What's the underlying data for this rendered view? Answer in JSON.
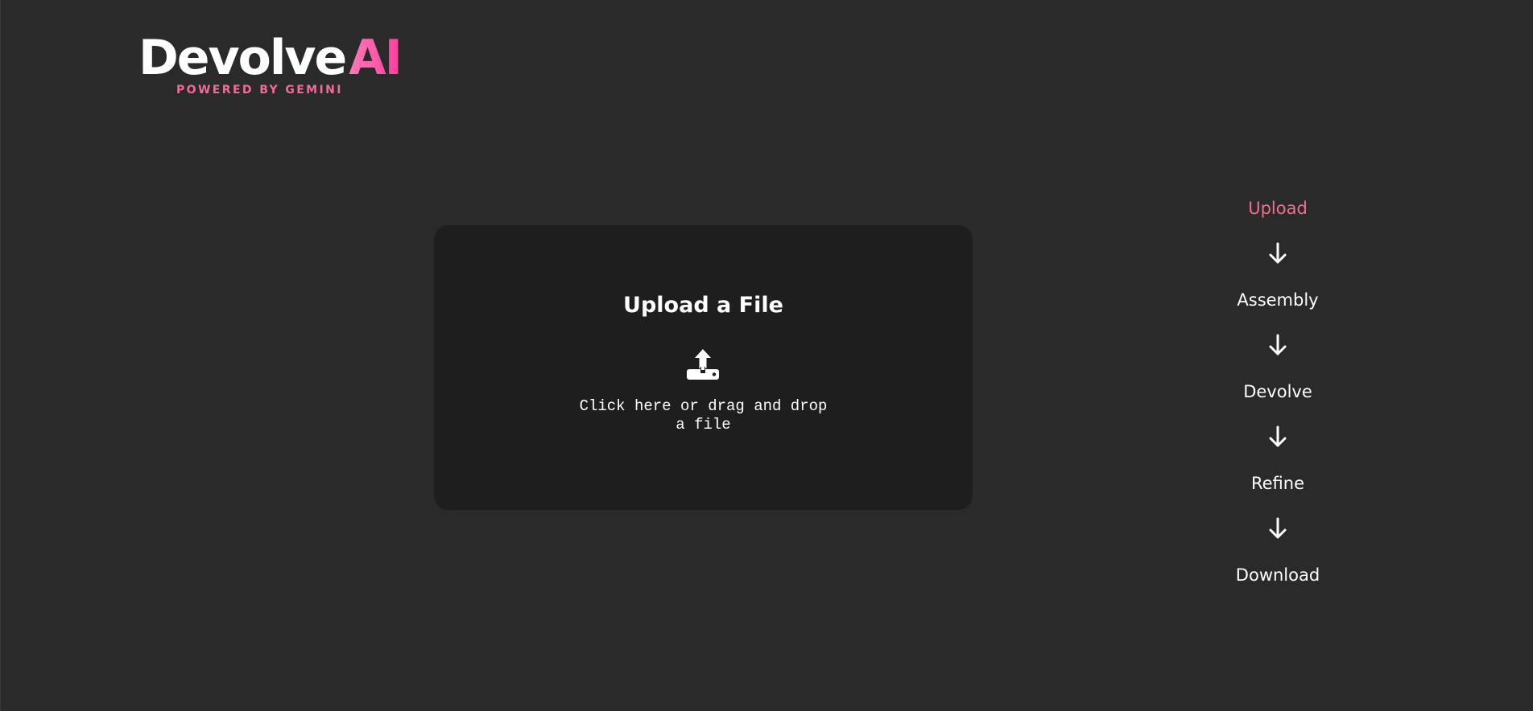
{
  "logo": {
    "word": "Devolve",
    "accent": "AI",
    "tagline": "POWERED BY GEMINI"
  },
  "upload": {
    "title": "Upload a File",
    "icon": "upload-tray-icon",
    "prompt_line1": "Click here or drag and drop",
    "prompt_line2": "a file"
  },
  "steps": [
    {
      "label": "Upload",
      "active": true
    },
    {
      "label": "Assembly",
      "active": false
    },
    {
      "label": "Devolve",
      "active": false
    },
    {
      "label": "Refine",
      "active": false
    },
    {
      "label": "Download",
      "active": false
    }
  ],
  "colors": {
    "background": "#2a2a2a",
    "card": "#1e1e1e",
    "accent_pink": "#f26d8e",
    "text": "#ffffff"
  }
}
